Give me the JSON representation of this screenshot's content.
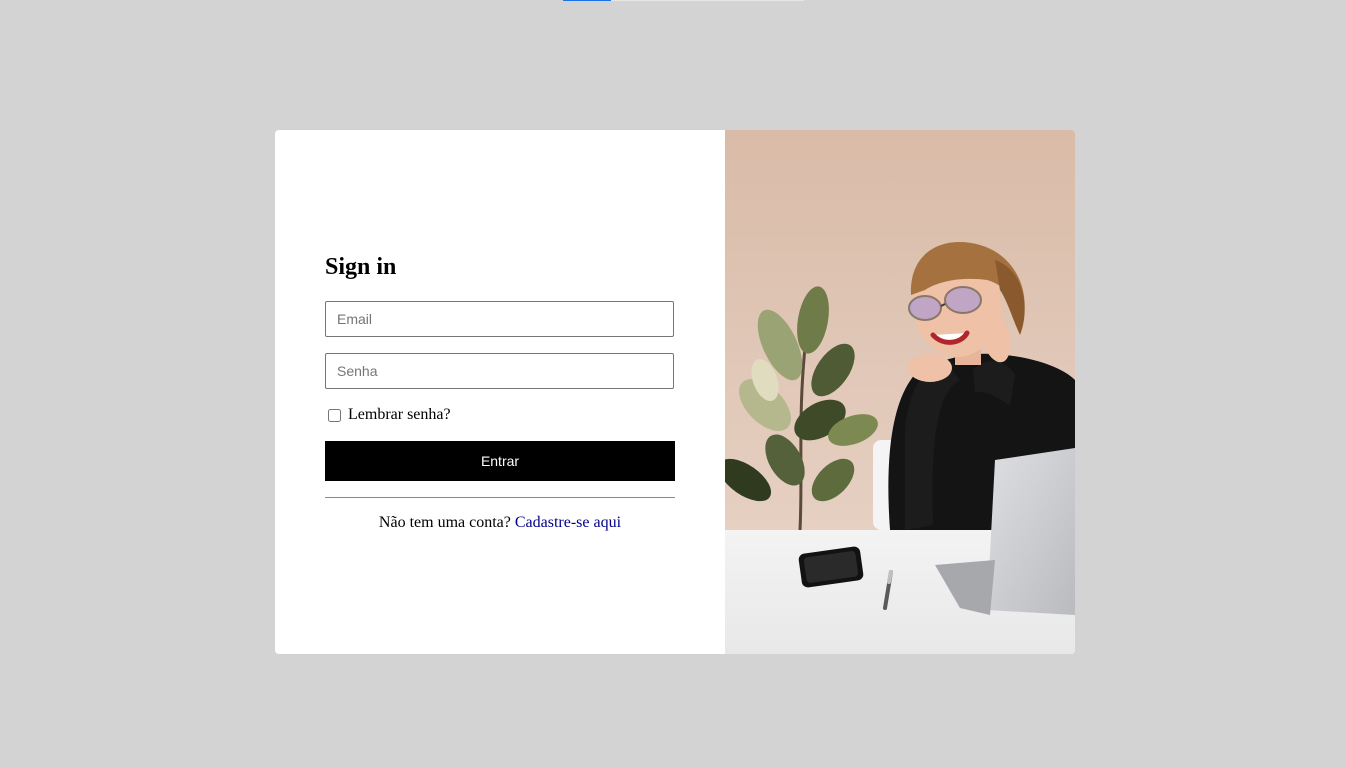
{
  "form": {
    "title": "Sign in",
    "email_placeholder": "Email",
    "password_placeholder": "Senha",
    "remember_label": "Lembrar senha?",
    "remember_checked": false,
    "submit_label": "Entrar",
    "signup_prompt": "Não tem uma conta?",
    "signup_link": "Cadastre-se aqui"
  },
  "colors": {
    "background": "#d3d3d3",
    "card": "#ffffff",
    "button": "#000000",
    "link": "#00008b"
  }
}
